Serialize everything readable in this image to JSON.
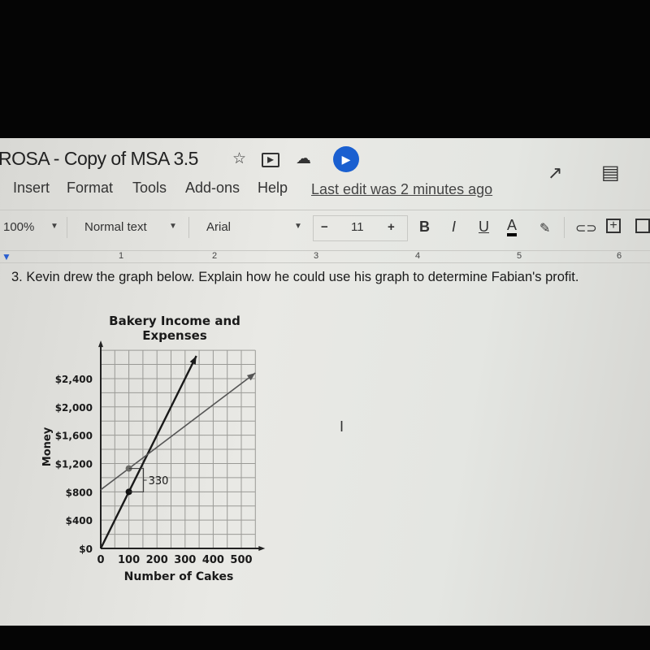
{
  "app": {
    "doc_title": "ROSA - Copy of MSA 3.5",
    "title_icons": [
      "star-icon",
      "move-to-folder-icon",
      "cloud-saved-icon",
      "present-icon"
    ],
    "top_right_icons": [
      "activity-trend-icon",
      "comments-icon"
    ],
    "menu": [
      "Insert",
      "Format",
      "Tools",
      "Add-ons",
      "Help"
    ],
    "last_edit": "Last edit was 2 minutes ago"
  },
  "toolbar": {
    "zoom": "100%",
    "style": "Normal text",
    "font": "Arial",
    "minus": "−",
    "font_size": "11",
    "plus": "+",
    "bold": "B",
    "italic": "I",
    "underline": "U",
    "text_color": "A",
    "text_color_value": "#000000",
    "extra_icons": [
      "highlight-icon",
      "link-icon",
      "add-comment-icon",
      "insert-image-icon"
    ]
  },
  "ruler": [
    "1",
    "2",
    "3",
    "4",
    "5",
    "6"
  ],
  "document": {
    "question": "3. Kevin drew the graph below.  Explain how he could use his graph to determine Fabian's profit.",
    "graph": {
      "type": "line",
      "title_line1": "Bakery Income and",
      "title_line2": "Expenses",
      "xlabel": "Number of Cakes",
      "ylabel": "Money",
      "xlim": [
        0,
        550
      ],
      "ylim": [
        0,
        2800
      ],
      "grid": true,
      "x_ticks": [
        0,
        100,
        200,
        300,
        400,
        500
      ],
      "x_tick_labels": [
        "0",
        "100",
        "200",
        "300",
        "400",
        "500"
      ],
      "y_ticks": [
        0,
        400,
        800,
        1200,
        1600,
        2000,
        2400
      ],
      "y_tick_labels": [
        "$0",
        "$400",
        "$800",
        "$1,200",
        "$1,600",
        "$2,000",
        "$2,400"
      ],
      "series": [
        {
          "points": [
            [
              0,
              0
            ],
            [
              100,
              800
            ],
            [
              340,
              2720
            ]
          ],
          "color": "#1a1a1a"
        },
        {
          "points": [
            [
              0,
              830
            ],
            [
              100,
              1130
            ],
            [
              550,
              2480
            ]
          ],
          "color": "#555555"
        }
      ],
      "marked_points": [
        [
          100,
          800
        ],
        [
          100,
          1130
        ]
      ],
      "annotation": "330"
    }
  }
}
